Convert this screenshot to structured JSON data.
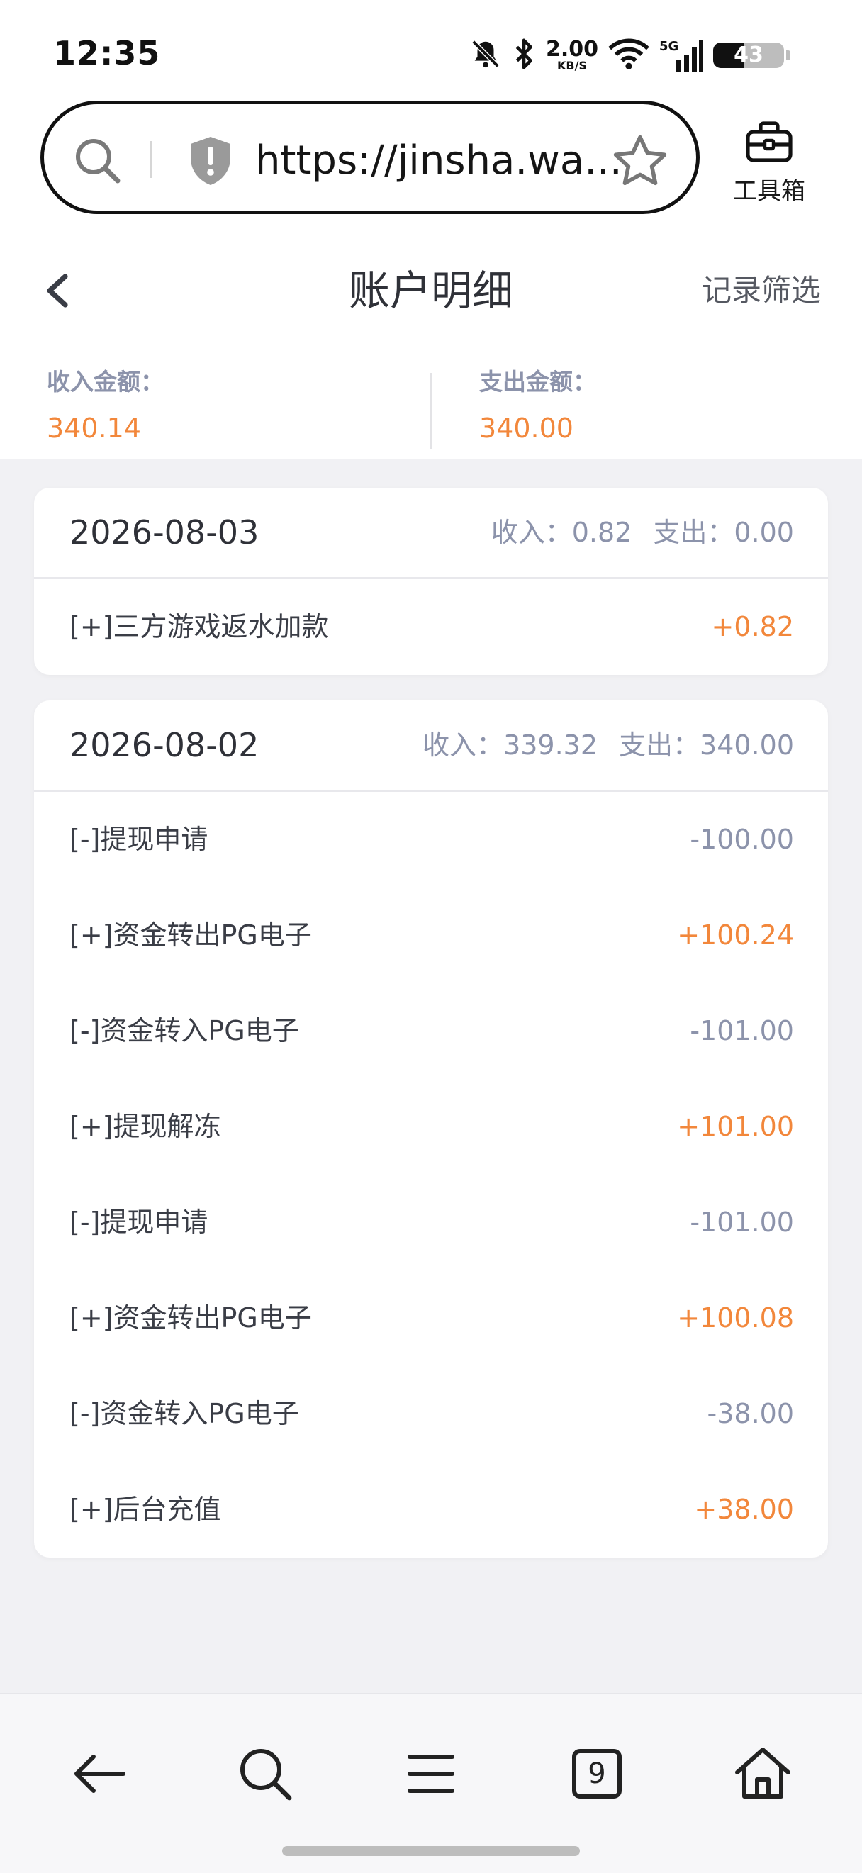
{
  "status_bar": {
    "time": "12:35",
    "net_speed_value": "2.00",
    "net_speed_unit": "KB/S",
    "network": "5G",
    "battery_level": "43",
    "icons": [
      "mute-bell-icon",
      "bluetooth-icon",
      "wifi-icon",
      "signal-icon",
      "battery-icon"
    ]
  },
  "browser": {
    "url": "https://jinsha.wa...",
    "toolbox_label": "工具箱",
    "icons": [
      "search-icon",
      "shield-alert-icon",
      "star-icon",
      "toolbox-icon"
    ]
  },
  "header": {
    "title": "账户明细",
    "filter_label": "记录筛选",
    "back_icon": "chevron-left-icon"
  },
  "summary": {
    "income_label": "收入金额：",
    "income_value": "340.14",
    "expense_label": "支出金额：",
    "expense_value": "340.00"
  },
  "days": [
    {
      "date": "2026-08-03",
      "income_text": "收入：0.82",
      "expense_text": "支出：0.00",
      "records": [
        {
          "label": "[+]三方游戏返水加款",
          "amount": "+0.82"
        }
      ]
    },
    {
      "date": "2026-08-02",
      "income_text": "收入：339.32",
      "expense_text": "支出：340.00",
      "records": [
        {
          "label": "[-]提现申请",
          "amount": "-100.00"
        },
        {
          "label": "[+]资金转出PG电子",
          "amount": "+100.24"
        },
        {
          "label": "[-]资金转入PG电子",
          "amount": "-101.00"
        },
        {
          "label": "[+]提现解冻",
          "amount": "+101.00"
        },
        {
          "label": "[-]提现申请",
          "amount": "-101.00"
        },
        {
          "label": "[+]资金转出PG电子",
          "amount": "+100.08"
        },
        {
          "label": "[-]资金转入PG电子",
          "amount": "-38.00"
        },
        {
          "label": "[+]后台充值",
          "amount": "+38.00"
        }
      ]
    }
  ],
  "bottom_nav": {
    "tab_count": "9",
    "icons": [
      "arrow-left-icon",
      "search-icon",
      "menu-icon",
      "tabs-icon",
      "home-icon"
    ]
  },
  "colors": {
    "accent_orange": "#f2873b",
    "muted_blue_gray": "#8c93ab",
    "page_bg": "#f1f1f4"
  }
}
